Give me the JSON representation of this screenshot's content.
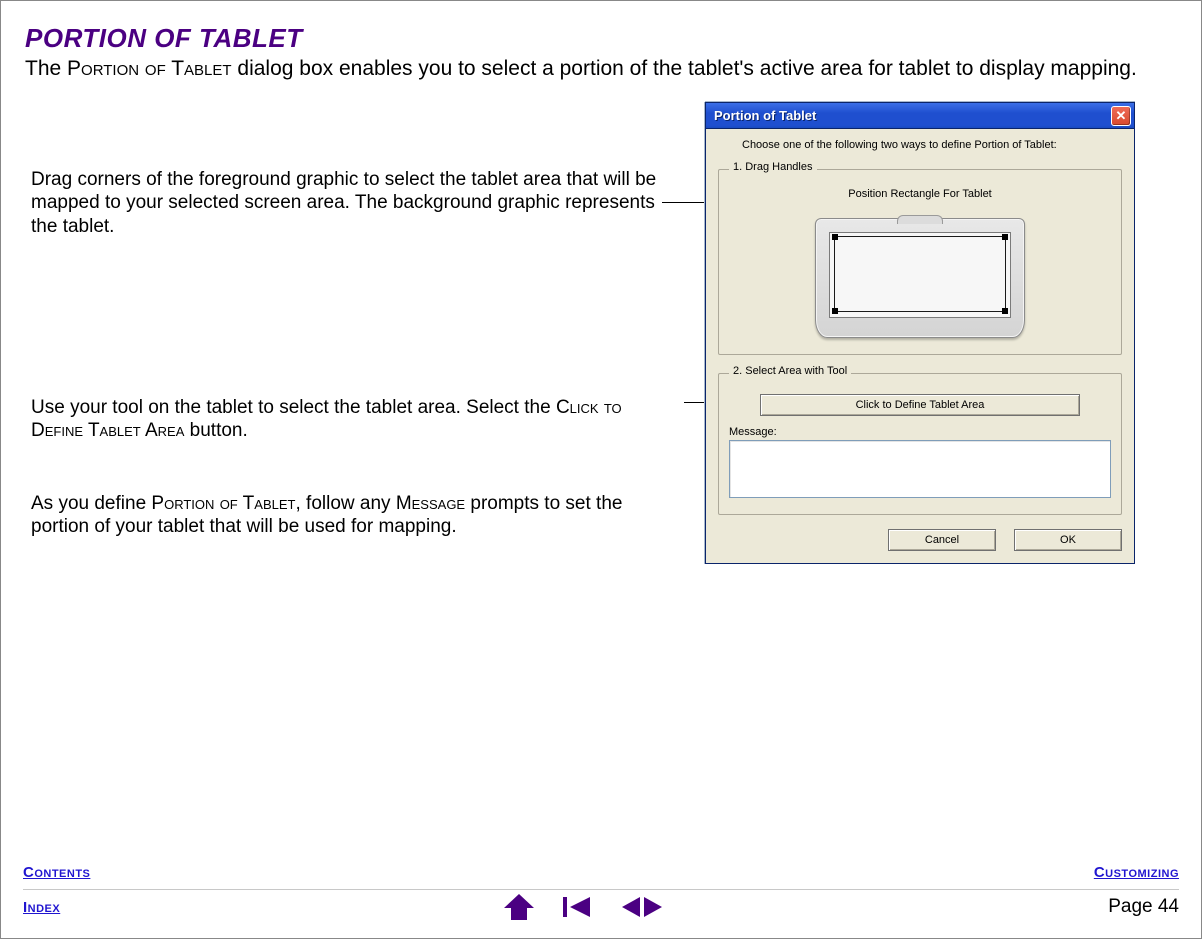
{
  "heading": "PORTION OF TABLET",
  "intro_parts": {
    "p1": "The ",
    "p2_sc": "Portion of Tablet",
    "p3": " dialog box enables you to select a portion of the tablet's active area for tablet to display mapping."
  },
  "callouts": {
    "drag": "Drag corners of the foreground graphic to select the tablet area that will be mapped to your selected screen area.  The background graphic represents the tablet.",
    "tool_p1": "Use your tool on the tablet to select the tablet area.  Select the ",
    "tool_sc": "Click to Define Tablet Area",
    "tool_p2": " button.",
    "msg_p1": "As you define ",
    "msg_sc1": "Portion of Tablet",
    "msg_p2": ", follow any  ",
    "msg_sc2": "Message",
    "msg_p3": " prompts to set the portion of your tablet that will be used for mapping."
  },
  "dialog": {
    "title": "Portion of Tablet",
    "instruction": "Choose one of the following  two ways to define Portion of Tablet:",
    "group1_legend": "1. Drag Handles",
    "group1_caption": "Position Rectangle For Tablet",
    "group2_legend": "2. Select Area with Tool",
    "define_btn": "Click to Define Tablet Area",
    "message_label": "Message:",
    "cancel": "Cancel",
    "ok": "OK"
  },
  "nav": {
    "contents": "Contents",
    "customizing": "Customizing",
    "index": "Index",
    "page_label": "Page  44"
  },
  "colors": {
    "heading": "#4b0082",
    "link": "#2015d0",
    "titlebar": "#1f4fcf",
    "close": "#d94a2e",
    "dialog_bg": "#ece9d8"
  }
}
